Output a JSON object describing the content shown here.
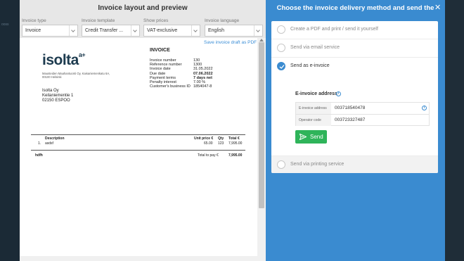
{
  "background": {
    "sidebar_text": "ooss"
  },
  "left_modal": {
    "title": "Invoice layout and preview",
    "fields": [
      {
        "label": "Invoice type",
        "value": "Invoice"
      },
      {
        "label": "Invoice template",
        "value": "Credit Transfer ..."
      },
      {
        "label": "Show prices",
        "value": "VAT-exclusive"
      },
      {
        "label": "Invoice language",
        "value": "English"
      }
    ],
    "save_link": "Save invoice draft as PDF"
  },
  "invoice": {
    "logo_text": "isolta",
    "logo_sup": "a+",
    "sender_address": "Mausteiden Maahantuonti Oy, Kaisaniemenkatu 6A,",
    "sender_city": "00100 Helsinki",
    "recipient": {
      "name": "Isolta Oy",
      "street": "Keilaniementie 1",
      "city": "02150 ESPOO"
    },
    "heading": "INVOICE",
    "meta": [
      {
        "key": "Invoice number",
        "value": "130",
        "bold": false
      },
      {
        "key": "Reference number",
        "value": "1300",
        "bold": false
      },
      {
        "key": "Invoice date",
        "value": "31.05.2022",
        "bold": false
      },
      {
        "key": "Due date",
        "value": "07.06.2022",
        "bold": true
      },
      {
        "key": "Payment terms",
        "value": "7 days net",
        "bold": true
      },
      {
        "key": "Penalty interest",
        "value": "7.00 %",
        "bold": false
      },
      {
        "key": "Customer's business ID",
        "value": "1854047-8",
        "bold": false
      }
    ],
    "table": {
      "headers": {
        "description": "Description",
        "unit_price": "Unit price €",
        "qty": "Qty",
        "total": "Total €"
      },
      "row": {
        "index": "1.",
        "description": "asdsf",
        "unit_price": "65.00",
        "qty": "123",
        "total": "7,995.00"
      },
      "footer_left": "hdfh",
      "total_label": "Total to pay €",
      "total_value": "7,995.00"
    }
  },
  "right_panel": {
    "title": "Choose the invoice delivery method and send the invoice",
    "options": [
      {
        "label": "Create a PDF and print / send it yourself",
        "selected": false
      },
      {
        "label": "Send via email service",
        "selected": false
      },
      {
        "label": "Send as e-invoice",
        "selected": true
      },
      {
        "label": "Send via printing service",
        "selected": false
      }
    ],
    "einvoice": {
      "title": "E-invoice address",
      "address_label": "E-invoice address",
      "address_value": "003718540478",
      "operator_label": "Operator code",
      "operator_value": "003723327487"
    },
    "send_label": "Send",
    "accent_color": "#3a8bd0",
    "send_color": "#2fb45a"
  }
}
